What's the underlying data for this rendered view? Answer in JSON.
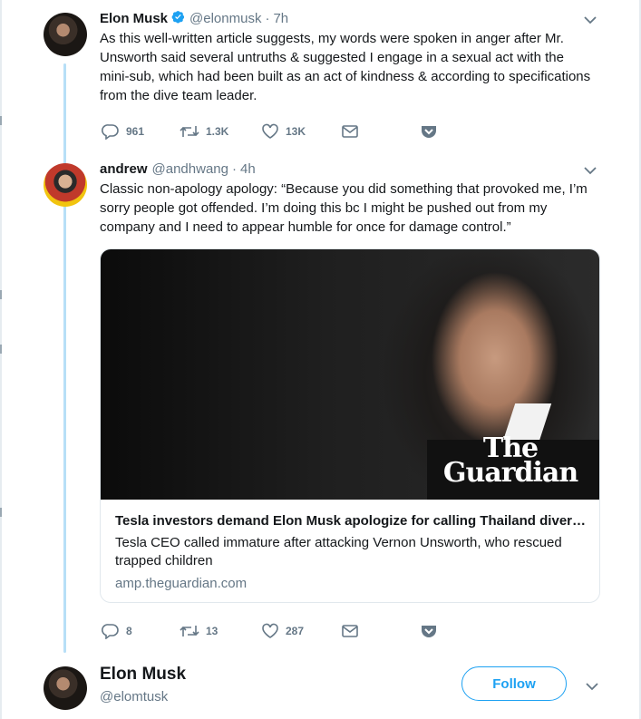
{
  "tweet1": {
    "name": "Elon Musk",
    "handle": "@elonmusk",
    "separator": "·",
    "time": "7h",
    "text": "As this well-written article suggests, my words were spoken in anger after Mr. Unsworth said several untruths & suggested I engage in a sexual act with the mini-sub, which had been built as an act of kindness & according to specifications from the dive team leader.",
    "replies": "961",
    "retweets": "1.3K",
    "likes": "13K"
  },
  "tweet2": {
    "name": "andrew",
    "handle": "@andhwang",
    "separator": "·",
    "time": "4h",
    "text": "Classic non-apology apology: “Because you did something that provoked me, I’m sorry people got offended. I’m doing this bc I might be pushed out from my company and I need to appear humble for once for damage control.”",
    "card": {
      "logo_line1": "The",
      "logo_line2": "Guardian",
      "title": "Tesla investors demand Elon Musk apologize for calling Thailand diver pedo",
      "description": "Tesla CEO called immature after attacking Vernon Unsworth, who rescued trapped children",
      "domain": "amp.theguardian.com"
    },
    "replies": "8",
    "retweets": "13",
    "likes": "287"
  },
  "profile": {
    "name": "Elon Musk",
    "handle": "@elomtusk",
    "follow_label": "Follow"
  },
  "colors": {
    "accent": "#1da1f2",
    "thread_line": "#b7dff7",
    "muted": "#657786",
    "text": "#14171a"
  },
  "icons": [
    "verified-badge-icon",
    "chevron-down-icon",
    "reply-icon",
    "retweet-icon",
    "like-icon",
    "direct-message-icon",
    "pocket-icon"
  ]
}
